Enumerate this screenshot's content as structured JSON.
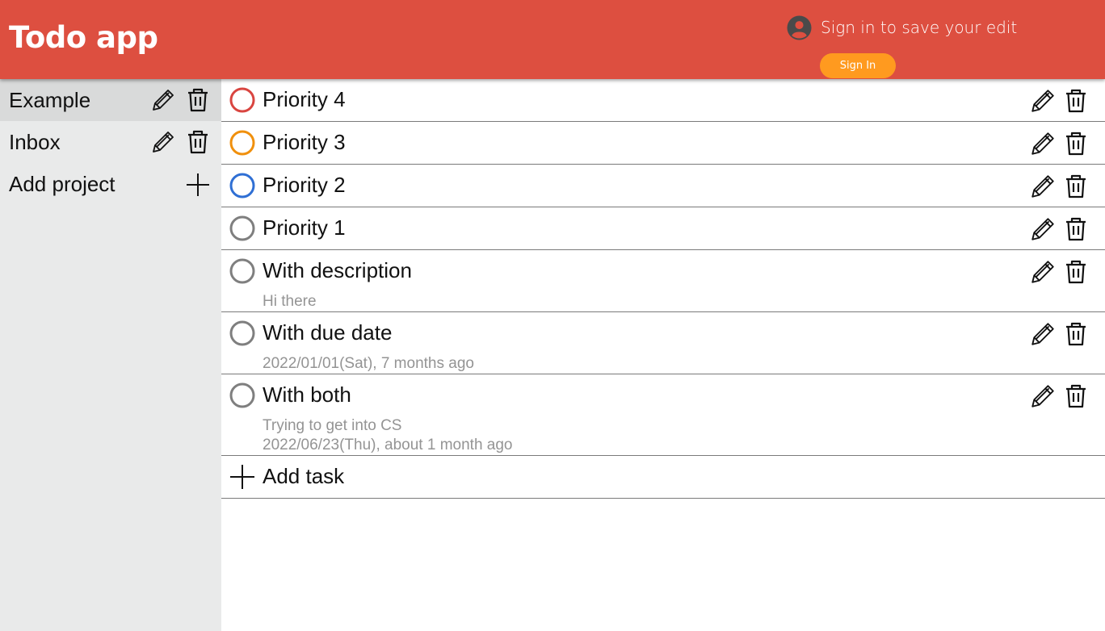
{
  "header": {
    "title": "Todo app",
    "signin_message": "Sign in to save your edit",
    "signin_button": "Sign In",
    "colors": {
      "header_bg": "#dd4f40",
      "button_bg": "#ff9a1f"
    }
  },
  "sidebar": {
    "projects": [
      {
        "label": "Example",
        "active": true
      },
      {
        "label": "Inbox",
        "active": false
      }
    ],
    "add_project_label": "Add project"
  },
  "tasks": [
    {
      "title": "Priority 4",
      "priority_color": "#d94540"
    },
    {
      "title": "Priority 3",
      "priority_color": "#f0900d"
    },
    {
      "title": "Priority 2",
      "priority_color": "#2f6fd4"
    },
    {
      "title": "Priority 1",
      "priority_color": "#7f7f7f"
    },
    {
      "title": "With description",
      "description": "Hi there",
      "priority_color": "#7f7f7f"
    },
    {
      "title": "With due date",
      "due": "2022/01/01(Sat), 7 months ago",
      "priority_color": "#7f7f7f"
    },
    {
      "title": "With both",
      "description": "Trying to get into CS",
      "due": "2022/06/23(Thu), about 1 month ago",
      "priority_color": "#7f7f7f"
    }
  ],
  "add_task_label": "Add task",
  "icons": {
    "avatar": "account-circle-icon",
    "edit": "pencil-icon",
    "delete": "trash-icon",
    "add": "plus-icon",
    "complete": "circle-checkbox-icon"
  }
}
